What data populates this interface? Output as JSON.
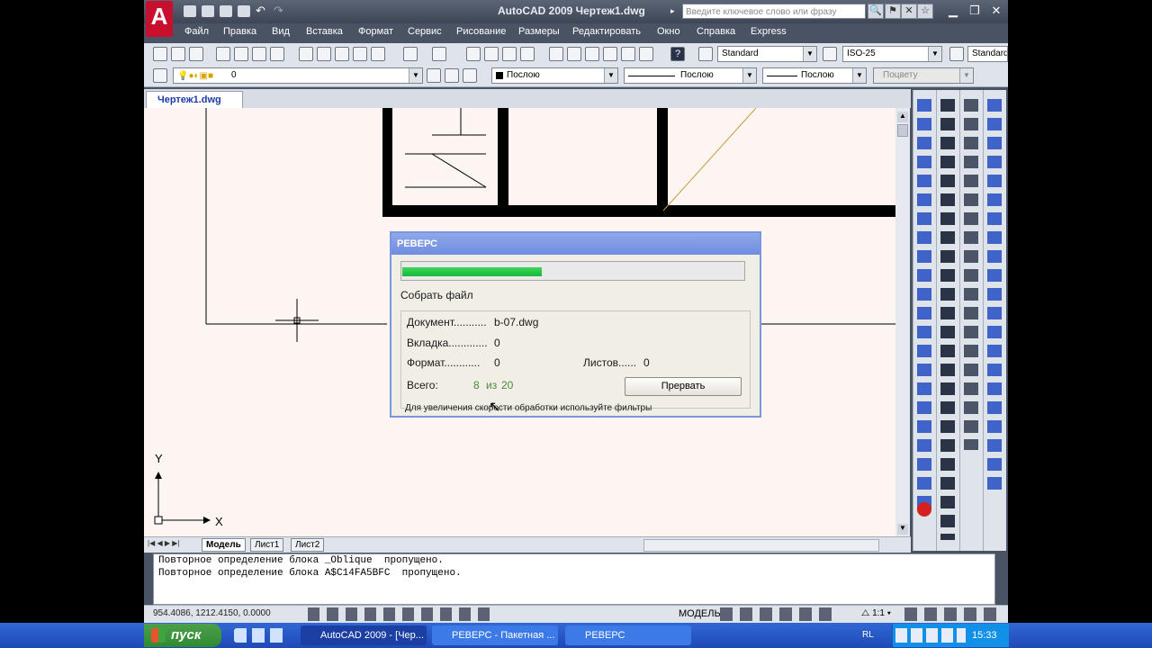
{
  "app": {
    "title": "AutoCAD 2009 Чертеж1.dwg",
    "search_placeholder": "Введите ключевое слово или фразу",
    "logo": "A"
  },
  "menu": [
    "Файл",
    "Правка",
    "Вид",
    "Вставка",
    "Формат",
    "Сервис",
    "Рисование",
    "Размеры",
    "Редактировать",
    "Окно",
    "Справка",
    "Express"
  ],
  "toolbar": {
    "text_style": "Standard",
    "dim_style": "ISO-25",
    "table_style": "Standard",
    "layer": "0",
    "color": "Послою",
    "linetype": "Послою",
    "lineweight": "Послою",
    "plotstyle": "Поцвету"
  },
  "doc_tab": "Чертеж1.dwg",
  "axes": {
    "x": "X",
    "y": "Y"
  },
  "layout_tabs": [
    "Модель",
    "Лист1",
    "Лист2"
  ],
  "command_lines": [
    "Повторное определение блока _Oblique  пропущено.",
    "Повторное определение блока A$C14FA5BFC  пропущено."
  ],
  "status": {
    "coords": "954.4086,  1212.4150, 0.0000",
    "model": "МОДЕЛЬ",
    "scale": "1:1"
  },
  "dialog": {
    "title": "РЕВЕРС",
    "progress": 0.41,
    "step": "Собрать файл",
    "document_label": "Документ...........",
    "document_value": "b-07.dwg",
    "tab_label": "Вкладка.............",
    "tab_value": "0",
    "format_label": "Формат............",
    "format_value": "0",
    "sheets_label": "Листов......",
    "sheets_value": "0",
    "total_label": "Всего:",
    "total_current": "8",
    "total_of": "из",
    "total_all": "20",
    "cancel": "Прервать",
    "hint": "Для увеличения скорости обработки используйте фильтры"
  },
  "taskbar": {
    "start": "пуск",
    "tasks": [
      "AutoCAD 2009 - [Чер...",
      "РЕВЕРС - Пакетная ...",
      "РЕВЕРС"
    ],
    "lang": "RL",
    "time": "15:33"
  }
}
